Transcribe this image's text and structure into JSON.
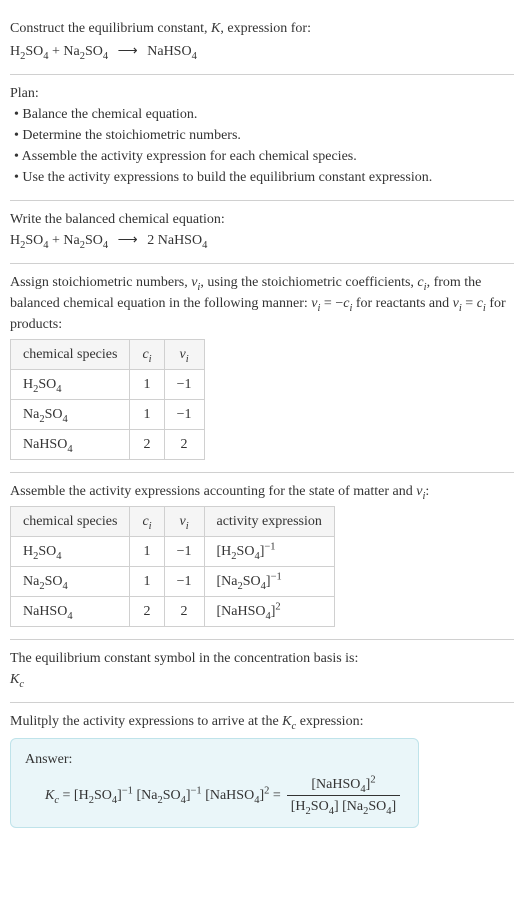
{
  "title_line1": "Construct the equilibrium constant, K, expression for:",
  "equation_unbalanced": "H₂SO₄ + Na₂SO₄ ⟶ NaHSO₄",
  "plan_heading": "Plan:",
  "plan_items": [
    "• Balance the chemical equation.",
    "• Determine the stoichiometric numbers.",
    "• Assemble the activity expression for each chemical species.",
    "• Use the activity expressions to build the equilibrium constant expression."
  ],
  "balanced_heading": "Write the balanced chemical equation:",
  "equation_balanced": "H₂SO₄ + Na₂SO₄ ⟶ 2 NaHSO₄",
  "stoich_intro": "Assign stoichiometric numbers, νᵢ, using the stoichiometric coefficients, cᵢ, from the balanced chemical equation in the following manner: νᵢ = −cᵢ for reactants and νᵢ = cᵢ for products:",
  "stoich_table": {
    "headers": {
      "species": "chemical species",
      "ci": "cᵢ",
      "vi": "νᵢ"
    },
    "rows": [
      {
        "species": "H₂SO₄",
        "ci": "1",
        "vi": "−1"
      },
      {
        "species": "Na₂SO₄",
        "ci": "1",
        "vi": "−1"
      },
      {
        "species": "NaHSO₄",
        "ci": "2",
        "vi": "2"
      }
    ]
  },
  "activity_intro": "Assemble the activity expressions accounting for the state of matter and νᵢ:",
  "activity_table": {
    "headers": {
      "species": "chemical species",
      "ci": "cᵢ",
      "vi": "νᵢ",
      "act": "activity expression"
    },
    "rows": [
      {
        "species": "H₂SO₄",
        "ci": "1",
        "vi": "−1",
        "act": "[H₂SO₄]⁻¹"
      },
      {
        "species": "Na₂SO₄",
        "ci": "1",
        "vi": "−1",
        "act": "[Na₂SO₄]⁻¹"
      },
      {
        "species": "NaHSO₄",
        "ci": "2",
        "vi": "2",
        "act": "[NaHSO₄]²"
      }
    ]
  },
  "kc_intro": "The equilibrium constant symbol in the concentration basis is:",
  "kc_symbol": "K_c",
  "multiply_line": "Mulitply the activity expressions to arrive at the K_c expression:",
  "answer_label": "Answer:",
  "answer_lhs": "K_c = [H₂SO₄]⁻¹ [Na₂SO₄]⁻¹ [NaHSO₄]² =",
  "answer_frac_num": "[NaHSO₄]²",
  "answer_frac_den": "[H₂SO₄] [Na₂SO₄]",
  "chart_data": {
    "type": "table",
    "stoichiometric_table": {
      "columns": [
        "chemical species",
        "c_i",
        "v_i"
      ],
      "rows": [
        [
          "H2SO4",
          1,
          -1
        ],
        [
          "Na2SO4",
          1,
          -1
        ],
        [
          "NaHSO4",
          2,
          2
        ]
      ]
    },
    "activity_table": {
      "columns": [
        "chemical species",
        "c_i",
        "v_i",
        "activity expression"
      ],
      "rows": [
        [
          "H2SO4",
          1,
          -1,
          "[H2SO4]^-1"
        ],
        [
          "Na2SO4",
          1,
          -1,
          "[Na2SO4]^-1"
        ],
        [
          "NaHSO4",
          2,
          2,
          "[NaHSO4]^2"
        ]
      ]
    },
    "equilibrium_expression": "K_c = [NaHSO4]^2 / ([H2SO4][Na2SO4])"
  }
}
